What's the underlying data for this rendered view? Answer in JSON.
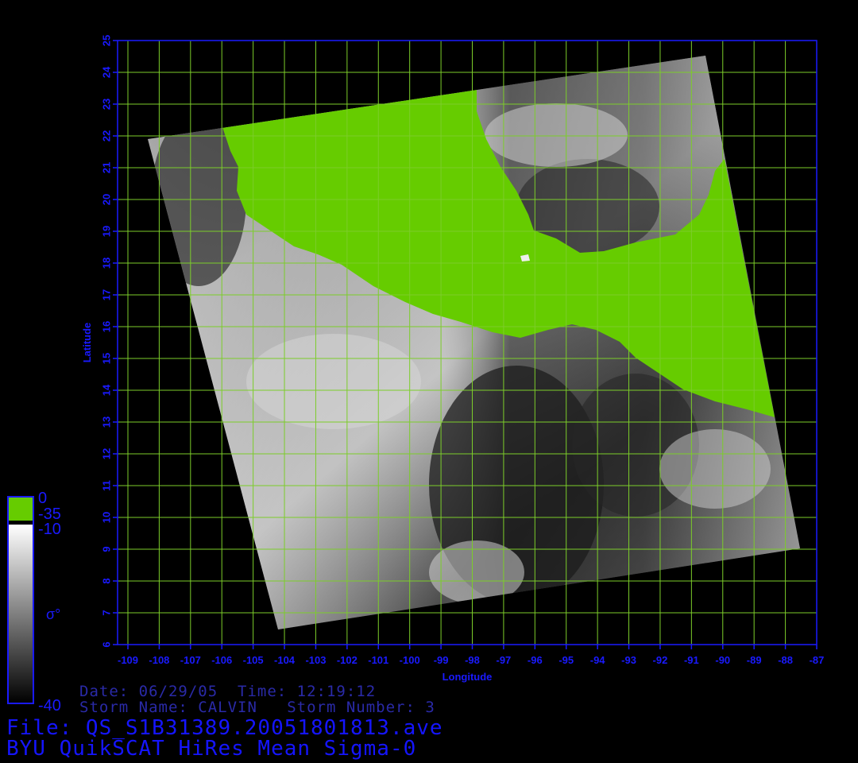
{
  "map": {
    "lon_range": [
      -109,
      -87
    ],
    "lat_range": [
      6,
      25
    ],
    "lon_ticks": [
      "-109",
      "-108",
      "-107",
      "-106",
      "-105",
      "-104",
      "-103",
      "-102",
      "-101",
      "-100",
      "-99",
      "-98",
      "-97",
      "-96",
      "-95",
      "-94",
      "-93",
      "-92",
      "-91",
      "-90",
      "-89",
      "-88",
      "-87"
    ],
    "lat_ticks": [
      "6",
      "7",
      "8",
      "9",
      "10",
      "11",
      "12",
      "13",
      "14",
      "15",
      "16",
      "17",
      "18",
      "19",
      "20",
      "21",
      "22",
      "23",
      "24",
      "25"
    ],
    "xlabel": "Longitude",
    "ylabel": "Latitude",
    "grid": true,
    "colors": {
      "grid": "#7ccd2a",
      "axis": "#1a1aff",
      "land": "#66cc00",
      "ocean_dark": "#202020",
      "ocean_light": "#c8c8c8"
    }
  },
  "colorbar": {
    "top_label": "0",
    "land_label": "-35",
    "upper_label": "-10",
    "symbol": "σ°",
    "bottom_label": "-40",
    "land_color": "#66cc00"
  },
  "info": {
    "line1": "Date: 06/29/05  Time: 12:19:12",
    "line2": "Storm Name: CALVIN   Storm Number: 3",
    "file": "File: QS_S1B31389.20051801813.ave",
    "product": "BYU QuikSCAT HiRes Mean Sigma-0"
  }
}
